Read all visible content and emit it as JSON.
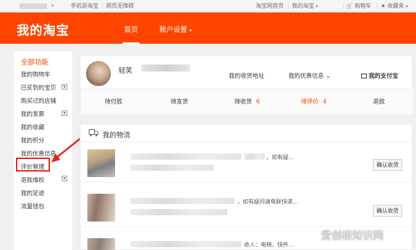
{
  "topbar": {
    "caret": "▾",
    "links": [
      "手机逛淘宝",
      "网页无障碍",
      "淘宝网首页",
      "我的淘宝",
      "购物车",
      "收藏夹"
    ],
    "cart_icon": "cart-icon",
    "fav_icon": "star-icon"
  },
  "header": {
    "logo": "我的淘宝",
    "nav": [
      "首页",
      "账户设置"
    ],
    "nav_caret": "▾",
    "brand_color": "#ff4400"
  },
  "sidebar": {
    "title": "全部功能",
    "items": [
      "我的购物车",
      "已买到的宝贝",
      "购买过的店铺",
      "我的发票",
      "我的收藏",
      "我的积分",
      "我的优惠信息",
      "评价管理",
      "退款维权",
      "我的足迹",
      "流量钱包"
    ],
    "expand_symbol": "▾",
    "highlighted_item": "评价管理",
    "highlight_color": "#e8221a"
  },
  "account": {
    "username_visible": "轻笑",
    "links": [
      "我的收货地址",
      "我的优惠信息",
      "我的支付宝"
    ],
    "coupon_caret": "⌄",
    "orders": [
      {
        "label": "待付款",
        "count": ""
      },
      {
        "label": "待发货",
        "count": ""
      },
      {
        "label": "待收货",
        "count": "6"
      },
      {
        "label": "待评价",
        "count": "4"
      },
      {
        "label": "退款",
        "count": ""
      }
    ]
  },
  "logistics": {
    "title": "我的物流",
    "rows": [
      {
        "snippet": "，如有疑...",
        "button": "确认收货"
      },
      {
        "snippet": "，如有疑问请电联快递...",
        "button": "确认收货"
      },
      {
        "snippet": "收人：电梯，快件...",
        "button": ""
      }
    ]
  },
  "watermark": "爱创根知识网"
}
